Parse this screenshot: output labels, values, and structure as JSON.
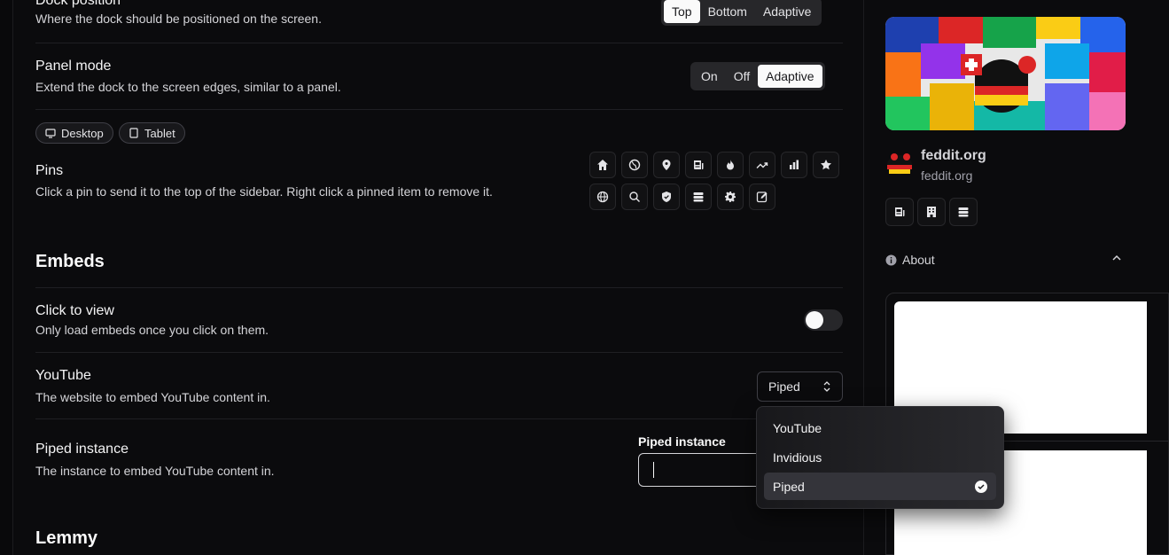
{
  "dock": {
    "title": "Dock position",
    "desc": "Where the dock should be positioned on the screen.",
    "options": [
      "Top",
      "Bottom",
      "Adaptive"
    ],
    "selected": "Top"
  },
  "panel": {
    "title": "Panel mode",
    "desc": "Extend the dock to the screen edges, similar to a panel.",
    "options": [
      "On",
      "Off",
      "Adaptive"
    ],
    "selected": "Adaptive"
  },
  "devices": {
    "desktop": "Desktop",
    "tablet": "Tablet"
  },
  "pins": {
    "title": "Pins",
    "desc": "Click a pin to send it to the top of the sidebar. Right click a pinned item to remove it.",
    "icons": [
      "home-icon",
      "globe-icon",
      "map-pin-icon",
      "newspaper-icon",
      "flame-icon",
      "trending-icon",
      "bar-chart-icon",
      "star-icon",
      "world-icon",
      "search-icon",
      "shield-icon",
      "server-icon",
      "gear-icon",
      "edit-icon"
    ]
  },
  "embeds": {
    "heading": "Embeds",
    "click_to_view": {
      "title": "Click to view",
      "desc": "Only load embeds once you click on them.",
      "enabled": false
    },
    "youtube": {
      "title": "YouTube",
      "desc": "The website to embed YouTube content in.",
      "value": "Piped",
      "options": [
        "YouTube",
        "Invidious",
        "Piped"
      ]
    },
    "piped": {
      "title": "Piped instance",
      "desc": "The instance to embed YouTube content in.",
      "label": "Piped instance",
      "value": ""
    }
  },
  "lemmy": {
    "heading": "Lemmy"
  },
  "sidebar": {
    "community_name": "feddit.org",
    "community_host": "feddit.org",
    "about": "About"
  },
  "colors": {
    "bg": "#0b0b0d",
    "accent": "#fafafa"
  }
}
